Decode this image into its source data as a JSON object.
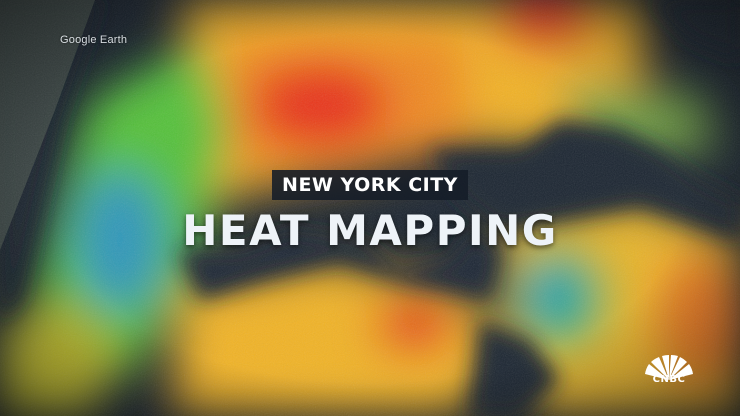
{
  "image": {
    "watermark": "Google Earth",
    "title": {
      "kicker": "NEW YORK CITY",
      "headline": "HEAT MAPPING"
    },
    "broadcaster_logo": "CNBC",
    "colors": {
      "water": "#1a2430",
      "hot": "#e5301f",
      "warm": "#f4b322",
      "cool": "#4fb82e",
      "cold": "#2d8fb8",
      "title_bg": "#141c28"
    }
  }
}
